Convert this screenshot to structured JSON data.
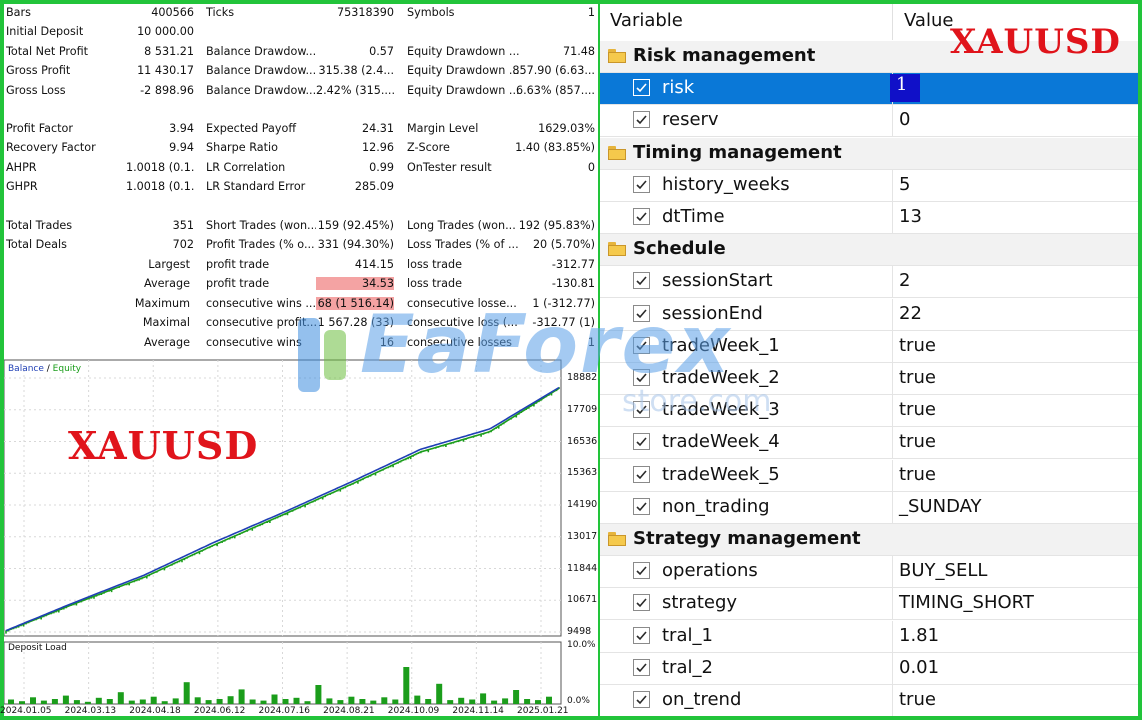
{
  "stats": {
    "block1": [
      [
        "Bars",
        "400566",
        "Ticks",
        "75318390",
        "Symbols",
        "1"
      ],
      [
        "Initial Deposit",
        "10 000.00",
        "",
        "",
        "",
        ""
      ],
      [
        "Total Net Profit",
        "8 531.21",
        "Balance Drawdow...",
        "0.57",
        "Equity Drawdown ...",
        "71.48"
      ],
      [
        "Gross Profit",
        "11 430.17",
        "Balance Drawdow...",
        "315.38 (2.4...",
        "Equity Drawdown ...",
        "857.90 (6.63..."
      ],
      [
        "Gross Loss",
        "-2 898.96",
        "Balance Drawdow...",
        "2.42% (315....",
        "Equity Drawdown ...",
        "6.63% (857...."
      ]
    ],
    "block2": [
      [
        "Profit Factor",
        "3.94",
        "Expected Payoff",
        "24.31",
        "Margin Level",
        "1629.03%"
      ],
      [
        "Recovery Factor",
        "9.94",
        "Sharpe Ratio",
        "12.96",
        "Z-Score",
        "1.40 (83.85%)"
      ],
      [
        "AHPR",
        "1.0018 (0.1...",
        "LR Correlation",
        "0.99",
        "OnTester result",
        "0"
      ],
      [
        "GHPR",
        "1.0018 (0.1...",
        "LR Standard Error",
        "285.09",
        "",
        ""
      ]
    ],
    "block3": [
      [
        "Total Trades",
        "351",
        "Short Trades (won...",
        "159 (92.45%)",
        "Long Trades (won...",
        "192 (95.83%)"
      ],
      [
        "Total Deals",
        "702",
        "Profit Trades (% o...",
        "331 (94.30%)",
        "Loss Trades (% of ...",
        "20 (5.70%)"
      ]
    ],
    "block4": [
      [
        "Largest",
        "profit trade",
        "414.15",
        "loss trade",
        "-312.77"
      ],
      [
        "Average",
        "profit trade",
        "34.53",
        "loss trade",
        "-130.81"
      ],
      [
        "Maximum",
        "consecutive wins ...",
        "68 (1 516.14)",
        "consecutive losse...",
        "1 (-312.77)"
      ],
      [
        "Maximal",
        "consecutive profit...",
        "1 567.28 (33)",
        "consecutive loss (...",
        "-312.77 (1)"
      ],
      [
        "Average",
        "consecutive wins",
        "16",
        "consecutive losses",
        "1"
      ]
    ]
  },
  "chart": {
    "legend_balance": "Balance",
    "legend_sep": " / ",
    "legend_equity": "Equity",
    "deposit_title": "Deposit Load",
    "title_overlay": "XAUUSD",
    "colors": {
      "balance": "#1f3fb5",
      "equity": "#1b9d1b",
      "deposit": "#1b9d1b"
    }
  },
  "chart_data": [
    {
      "type": "line",
      "title": "",
      "series": [
        {
          "name": "Balance",
          "x": [
            "2024.01.05",
            "2024.03.13",
            "2024.04.18",
            "2024.06.12",
            "2024.07.16",
            "2024.08.21",
            "2024.10.09",
            "2024.11.14",
            "2025.01.21"
          ],
          "values": [
            9550,
            10600,
            11600,
            12800,
            13900,
            15050,
            16250,
            17000,
            18530
          ]
        },
        {
          "name": "Equity",
          "x": [
            "2024.01.05",
            "2024.03.13",
            "2024.04.18",
            "2024.06.12",
            "2024.07.16",
            "2024.08.21",
            "2024.10.09",
            "2024.11.14",
            "2025.01.21"
          ],
          "values": [
            9530,
            10550,
            11520,
            12700,
            13820,
            14960,
            16150,
            16900,
            18500
          ]
        }
      ],
      "x_tick_labels": [
        "2024.01.05",
        "2024.03.13",
        "2024.04.18",
        "2024.06.12",
        "2024.07.16",
        "2024.08.21",
        "2024.10.09",
        "2024.11.14",
        "2025.01.21"
      ],
      "y_tick_labels": [
        "18882",
        "17709",
        "16536",
        "15363",
        "14190",
        "13017",
        "11844",
        "10671",
        "9498"
      ],
      "ylim": [
        9498,
        18882
      ],
      "grid": true
    },
    {
      "type": "bar",
      "title": "Deposit Load",
      "y_tick_labels": [
        "10.0%",
        "0.0%"
      ],
      "ylim": [
        0,
        10
      ],
      "values": [
        0.8,
        0.5,
        1.2,
        0.6,
        0.9,
        1.5,
        0.7,
        0.4,
        1.1,
        0.9,
        2.1,
        0.6,
        0.8,
        1.3,
        0.5,
        1.0,
        3.9,
        1.2,
        0.7,
        0.9,
        1.4,
        2.6,
        0.8,
        0.6,
        1.7,
        0.9,
        1.1,
        0.5,
        3.4,
        1.0,
        0.7,
        1.3,
        0.9,
        0.6,
        1.2,
        0.8,
        6.6,
        1.5,
        0.9,
        3.6,
        0.7,
        1.1,
        0.8,
        1.9,
        0.6,
        1.0,
        2.5,
        0.9,
        0.7,
        1.3
      ]
    }
  ],
  "grid": {
    "header_variable": "Variable",
    "header_value": "Value",
    "title_overlay": "XAUUSD",
    "rows": [
      {
        "type": "group",
        "label": "Risk management"
      },
      {
        "type": "param",
        "name": "risk",
        "value": "1",
        "selected": true
      },
      {
        "type": "param",
        "name": "reserv",
        "value": "0"
      },
      {
        "type": "group",
        "label": "Timing management"
      },
      {
        "type": "param",
        "name": "history_weeks",
        "value": "5"
      },
      {
        "type": "param",
        "name": "dtTime",
        "value": "13"
      },
      {
        "type": "group",
        "label": "Schedule"
      },
      {
        "type": "param",
        "name": "sessionStart",
        "value": "2"
      },
      {
        "type": "param",
        "name": "sessionEnd",
        "value": "22"
      },
      {
        "type": "param",
        "name": "tradeWeek_1",
        "value": "true"
      },
      {
        "type": "param",
        "name": "tradeWeek_2",
        "value": "true"
      },
      {
        "type": "param",
        "name": "tradeWeek_3",
        "value": "true"
      },
      {
        "type": "param",
        "name": "tradeWeek_4",
        "value": "true"
      },
      {
        "type": "param",
        "name": "tradeWeek_5",
        "value": "true"
      },
      {
        "type": "param",
        "name": "non_trading",
        "value": "_SUNDAY"
      },
      {
        "type": "group",
        "label": "Strategy management"
      },
      {
        "type": "param",
        "name": "operations",
        "value": "BUY_SELL"
      },
      {
        "type": "param",
        "name": "strategy",
        "value": "TIMING_SHORT"
      },
      {
        "type": "param",
        "name": "tral_1",
        "value": "1.81"
      },
      {
        "type": "param",
        "name": "tral_2",
        "value": "0.01"
      },
      {
        "type": "param",
        "name": "on_trend",
        "value": "true"
      }
    ]
  },
  "watermark": {
    "main": "EaForex",
    "sub": "store.com"
  }
}
